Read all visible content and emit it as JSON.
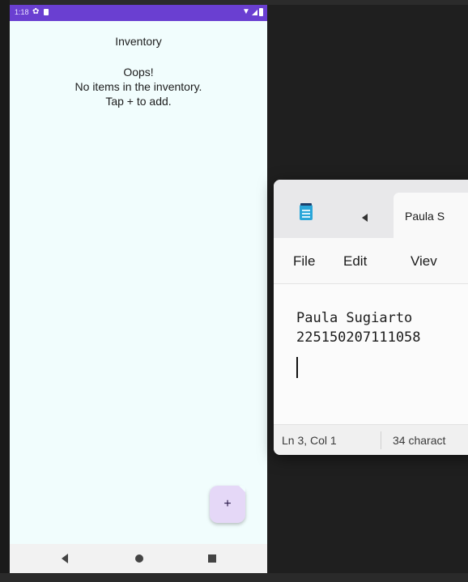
{
  "emulator": {
    "status_bar": {
      "time": "1:18",
      "settings_icon": "gear-icon",
      "sd_icon": "sd-card-icon",
      "wifi_icon": "wifi-icon",
      "signal_icon": "signal-icon",
      "battery_icon": "battery-icon",
      "color": "#6a3fd1"
    },
    "app": {
      "title": "Inventory",
      "empty_state": {
        "line1": "Oops!",
        "line2": "No items in the inventory.",
        "line3": "Tap + to add."
      },
      "fab_label": "+",
      "fab_color": "#e5d8f7",
      "background": "#f1fdfd"
    },
    "nav_bar": {
      "back_icon": "back-triangle-icon",
      "home_icon": "home-circle-icon",
      "recents_icon": "recents-square-icon"
    }
  },
  "notepad": {
    "app_icon": "notepad-icon",
    "tab_scroll_icon": "chevron-left-icon",
    "tab_title": "Paula S",
    "menu": {
      "file": "File",
      "edit": "Edit",
      "view": "Viev"
    },
    "content": {
      "line1": "Paula Sugiarto",
      "line2": "225150207111058",
      "line3": ""
    },
    "status": {
      "position": "Ln 3, Col 1",
      "characters": "34 charact"
    }
  }
}
